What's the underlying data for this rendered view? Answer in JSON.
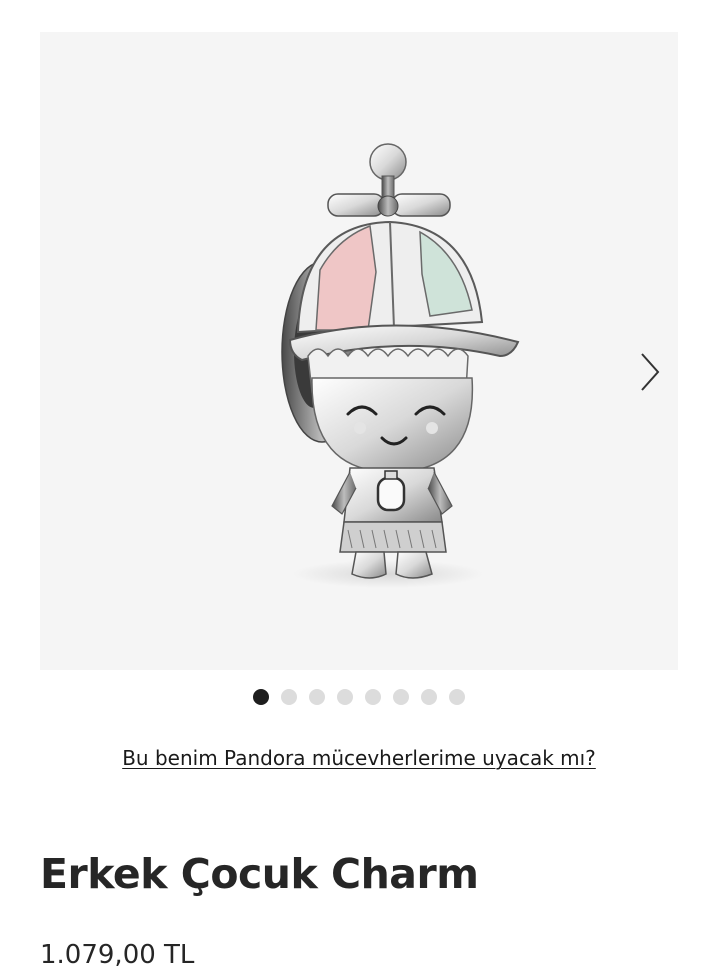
{
  "gallery": {
    "image_alt": "Erkek Çocuk Charm",
    "next_icon": "chevron-right-icon",
    "dots": {
      "total": 8,
      "active_index": 0
    }
  },
  "fit_link": "Bu benim Pandora mücevherlerime uyacak mı?",
  "product": {
    "title": "Erkek Çocuk Charm",
    "price": "1.079,00 TL"
  }
}
